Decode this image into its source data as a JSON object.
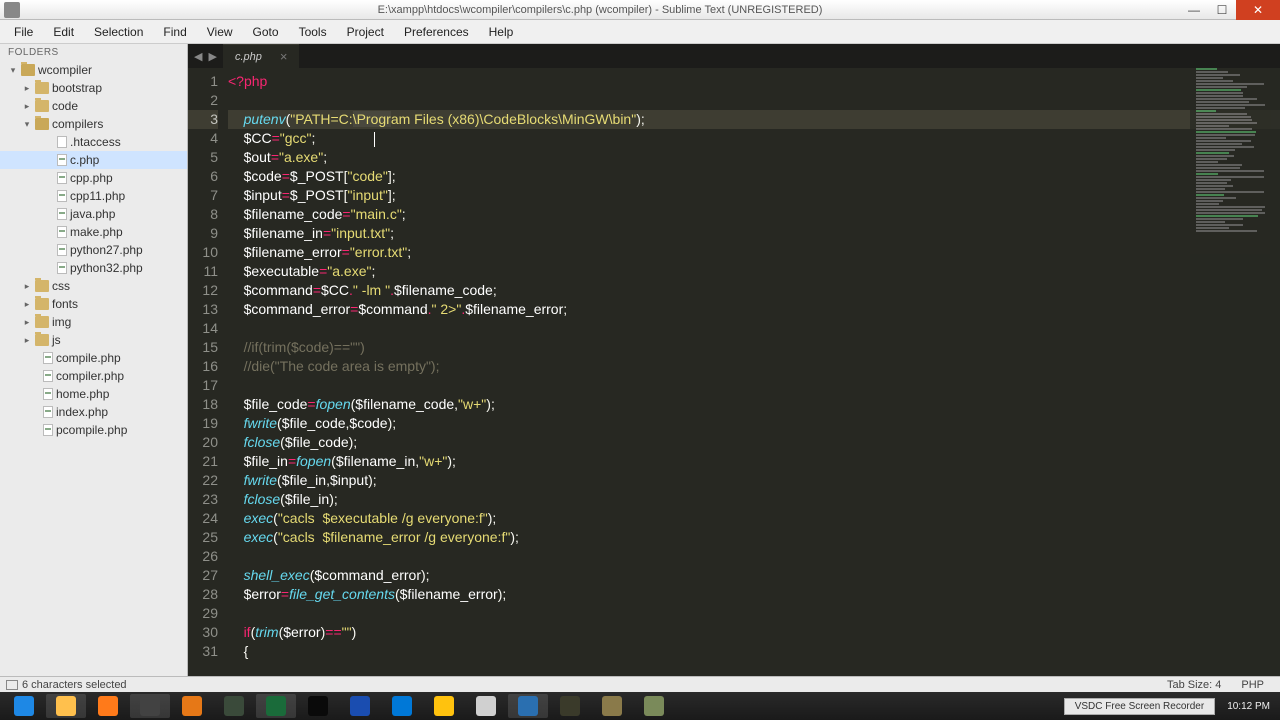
{
  "window": {
    "title": "E:\\xampp\\htdocs\\wcompiler\\compilers\\c.php (wcompiler) - Sublime Text (UNREGISTERED)"
  },
  "menu": [
    "File",
    "Edit",
    "Selection",
    "Find",
    "View",
    "Goto",
    "Tools",
    "Project",
    "Preferences",
    "Help"
  ],
  "sidebar": {
    "header": "FOLDERS",
    "items": [
      {
        "pad": 8,
        "disc": "▾",
        "icon": "fold open",
        "label": "wcompiler"
      },
      {
        "pad": 22,
        "disc": "▸",
        "icon": "fold",
        "label": "bootstrap"
      },
      {
        "pad": 22,
        "disc": "▸",
        "icon": "fold",
        "label": "code"
      },
      {
        "pad": 22,
        "disc": "▾",
        "icon": "fold open",
        "label": "compilers"
      },
      {
        "pad": 44,
        "disc": "",
        "icon": "file",
        "label": ".htaccess"
      },
      {
        "pad": 44,
        "disc": "",
        "icon": "file php",
        "label": "c.php",
        "sel": true
      },
      {
        "pad": 44,
        "disc": "",
        "icon": "file php",
        "label": "cpp.php"
      },
      {
        "pad": 44,
        "disc": "",
        "icon": "file php",
        "label": "cpp11.php"
      },
      {
        "pad": 44,
        "disc": "",
        "icon": "file php",
        "label": "java.php"
      },
      {
        "pad": 44,
        "disc": "",
        "icon": "file php",
        "label": "make.php"
      },
      {
        "pad": 44,
        "disc": "",
        "icon": "file php",
        "label": "python27.php"
      },
      {
        "pad": 44,
        "disc": "",
        "icon": "file php",
        "label": "python32.php"
      },
      {
        "pad": 22,
        "disc": "▸",
        "icon": "fold",
        "label": "css"
      },
      {
        "pad": 22,
        "disc": "▸",
        "icon": "fold",
        "label": "fonts"
      },
      {
        "pad": 22,
        "disc": "▸",
        "icon": "fold",
        "label": "img"
      },
      {
        "pad": 22,
        "disc": "▸",
        "icon": "fold",
        "label": "js"
      },
      {
        "pad": 30,
        "disc": "",
        "icon": "file php",
        "label": "compile.php"
      },
      {
        "pad": 30,
        "disc": "",
        "icon": "file php",
        "label": "compiler.php"
      },
      {
        "pad": 30,
        "disc": "",
        "icon": "file php",
        "label": "home.php"
      },
      {
        "pad": 30,
        "disc": "",
        "icon": "file php",
        "label": "index.php"
      },
      {
        "pad": 30,
        "disc": "",
        "icon": "file php",
        "label": "pcompile.php"
      }
    ]
  },
  "tab": {
    "label": "c.php",
    "close": "×"
  },
  "nav": {
    "back": "◀",
    "fwd": "▶"
  },
  "code_lines": [
    {
      "n": 1,
      "html": "<span class='o'>&lt;?</span><span class='k'>php</span>"
    },
    {
      "n": 2,
      "html": ""
    },
    {
      "n": 3,
      "hl": true,
      "html": "    <span class='f'>putenv</span><span class='p'>(</span><span class='s'>\"PATH=C:<span class='sel'>\\Progr</span>am Files (x86)\\CodeBlocks\\MinGW\\bin\"</span><span class='p'>);</span>"
    },
    {
      "n": 4,
      "html": "    <span class='v'>$CC</span><span class='o'>=</span><span class='s'>\"gcc\"</span><span class='p'>;</span>               <span class='cursor-caret'></span>"
    },
    {
      "n": 5,
      "html": "    <span class='v'>$out</span><span class='o'>=</span><span class='s'>\"a.exe\"</span><span class='p'>;</span>"
    },
    {
      "n": 6,
      "html": "    <span class='v'>$code</span><span class='o'>=</span><span class='v'>$_POST</span><span class='p'>[</span><span class='s'>\"code\"</span><span class='p'>];</span>"
    },
    {
      "n": 7,
      "html": "    <span class='v'>$input</span><span class='o'>=</span><span class='v'>$_POST</span><span class='p'>[</span><span class='s'>\"input\"</span><span class='p'>];</span>"
    },
    {
      "n": 8,
      "html": "    <span class='v'>$filename_code</span><span class='o'>=</span><span class='s'>\"main.c\"</span><span class='p'>;</span>"
    },
    {
      "n": 9,
      "html": "    <span class='v'>$filename_in</span><span class='o'>=</span><span class='s'>\"input.txt\"</span><span class='p'>;</span>"
    },
    {
      "n": 10,
      "html": "    <span class='v'>$filename_error</span><span class='o'>=</span><span class='s'>\"error.txt\"</span><span class='p'>;</span>"
    },
    {
      "n": 11,
      "html": "    <span class='v'>$executable</span><span class='o'>=</span><span class='s'>\"a.exe\"</span><span class='p'>;</span>"
    },
    {
      "n": 12,
      "html": "    <span class='v'>$command</span><span class='o'>=</span><span class='v'>$CC</span><span class='o'>.</span><span class='s'>\" -lm \"</span><span class='o'>.</span><span class='v'>$filename_code</span><span class='p'>;</span>"
    },
    {
      "n": 13,
      "html": "    <span class='v'>$command_error</span><span class='o'>=</span><span class='v'>$command</span><span class='o'>.</span><span class='s'>\" 2&gt;\"</span><span class='o'>.</span><span class='v'>$filename_error</span><span class='p'>;</span>"
    },
    {
      "n": 14,
      "html": ""
    },
    {
      "n": 15,
      "html": "    <span class='c'>//if(trim($code)==\"\")</span>"
    },
    {
      "n": 16,
      "html": "    <span class='c'>//die(\"The code area is empty\");</span>"
    },
    {
      "n": 17,
      "html": ""
    },
    {
      "n": 18,
      "html": "    <span class='v'>$file_code</span><span class='o'>=</span><span class='f'>fopen</span><span class='p'>(</span><span class='v'>$filename_code</span><span class='p'>,</span><span class='s'>\"w+\"</span><span class='p'>);</span>"
    },
    {
      "n": 19,
      "html": "    <span class='f'>fwrite</span><span class='p'>(</span><span class='v'>$file_code</span><span class='p'>,</span><span class='v'>$code</span><span class='p'>);</span>"
    },
    {
      "n": 20,
      "html": "    <span class='f'>fclose</span><span class='p'>(</span><span class='v'>$file_code</span><span class='p'>);</span>"
    },
    {
      "n": 21,
      "html": "    <span class='v'>$file_in</span><span class='o'>=</span><span class='f'>fopen</span><span class='p'>(</span><span class='v'>$filename_in</span><span class='p'>,</span><span class='s'>\"w+\"</span><span class='p'>);</span>"
    },
    {
      "n": 22,
      "html": "    <span class='f'>fwrite</span><span class='p'>(</span><span class='v'>$file_in</span><span class='p'>,</span><span class='v'>$input</span><span class='p'>);</span>"
    },
    {
      "n": 23,
      "html": "    <span class='f'>fclose</span><span class='p'>(</span><span class='v'>$file_in</span><span class='p'>);</span>"
    },
    {
      "n": 24,
      "html": "    <span class='f'>exec</span><span class='p'>(</span><span class='s'>\"cacls  $executable /g everyone:f\"</span><span class='p'>);</span>"
    },
    {
      "n": 25,
      "html": "    <span class='f'>exec</span><span class='p'>(</span><span class='s'>\"cacls  $filename_error /g everyone:f\"</span><span class='p'>);</span>"
    },
    {
      "n": 26,
      "html": ""
    },
    {
      "n": 27,
      "html": "    <span class='f'>shell_exec</span><span class='p'>(</span><span class='v'>$command_error</span><span class='p'>);</span>"
    },
    {
      "n": 28,
      "html": "    <span class='v'>$error</span><span class='o'>=</span><span class='f'>file_get_contents</span><span class='p'>(</span><span class='v'>$filename_error</span><span class='p'>);</span>"
    },
    {
      "n": 29,
      "html": ""
    },
    {
      "n": 30,
      "html": "    <span class='k'>if</span><span class='p'>(</span><span class='f'>trim</span><span class='p'>(</span><span class='v'>$error</span><span class='p'>)</span><span class='o'>==</span><span class='s'>\"\"</span><span class='p'>)</span>"
    },
    {
      "n": 31,
      "html": "    <span class='p'>{</span>"
    }
  ],
  "status": {
    "left": "6 characters selected",
    "tabsize": "Tab Size: 4",
    "lang": "PHP"
  },
  "taskbar": {
    "icons": [
      {
        "bg": "#1e88e5",
        "name": "ie"
      },
      {
        "bg": "#ffc04d",
        "name": "explorer",
        "active": true
      },
      {
        "bg": "#ff7a1a",
        "name": "firefox"
      },
      {
        "bg": "#424242",
        "name": "sublime",
        "active": true
      },
      {
        "bg": "#e67817",
        "name": "xampp"
      },
      {
        "bg": "#3a4a3a",
        "name": "app6"
      },
      {
        "bg": "#1a6b3a",
        "name": "webstorm",
        "active": true
      },
      {
        "bg": "#0a0a0a",
        "name": "terminal"
      },
      {
        "bg": "#1a4db0",
        "name": "photoshop"
      },
      {
        "bg": "#0078d7",
        "name": "vscode"
      },
      {
        "bg": "#ffc20e",
        "name": "player"
      },
      {
        "bg": "#d0d0d0",
        "name": "app12"
      },
      {
        "bg": "#2a6fb0",
        "name": "app13",
        "active": true
      },
      {
        "bg": "#3a3a2a",
        "name": "app14"
      },
      {
        "bg": "#8a7a4a",
        "name": "app15"
      },
      {
        "bg": "#7a8a5a",
        "name": "app16"
      }
    ],
    "vsdc": "VSDC Free Screen Recorder",
    "time": "10:12 PM"
  }
}
